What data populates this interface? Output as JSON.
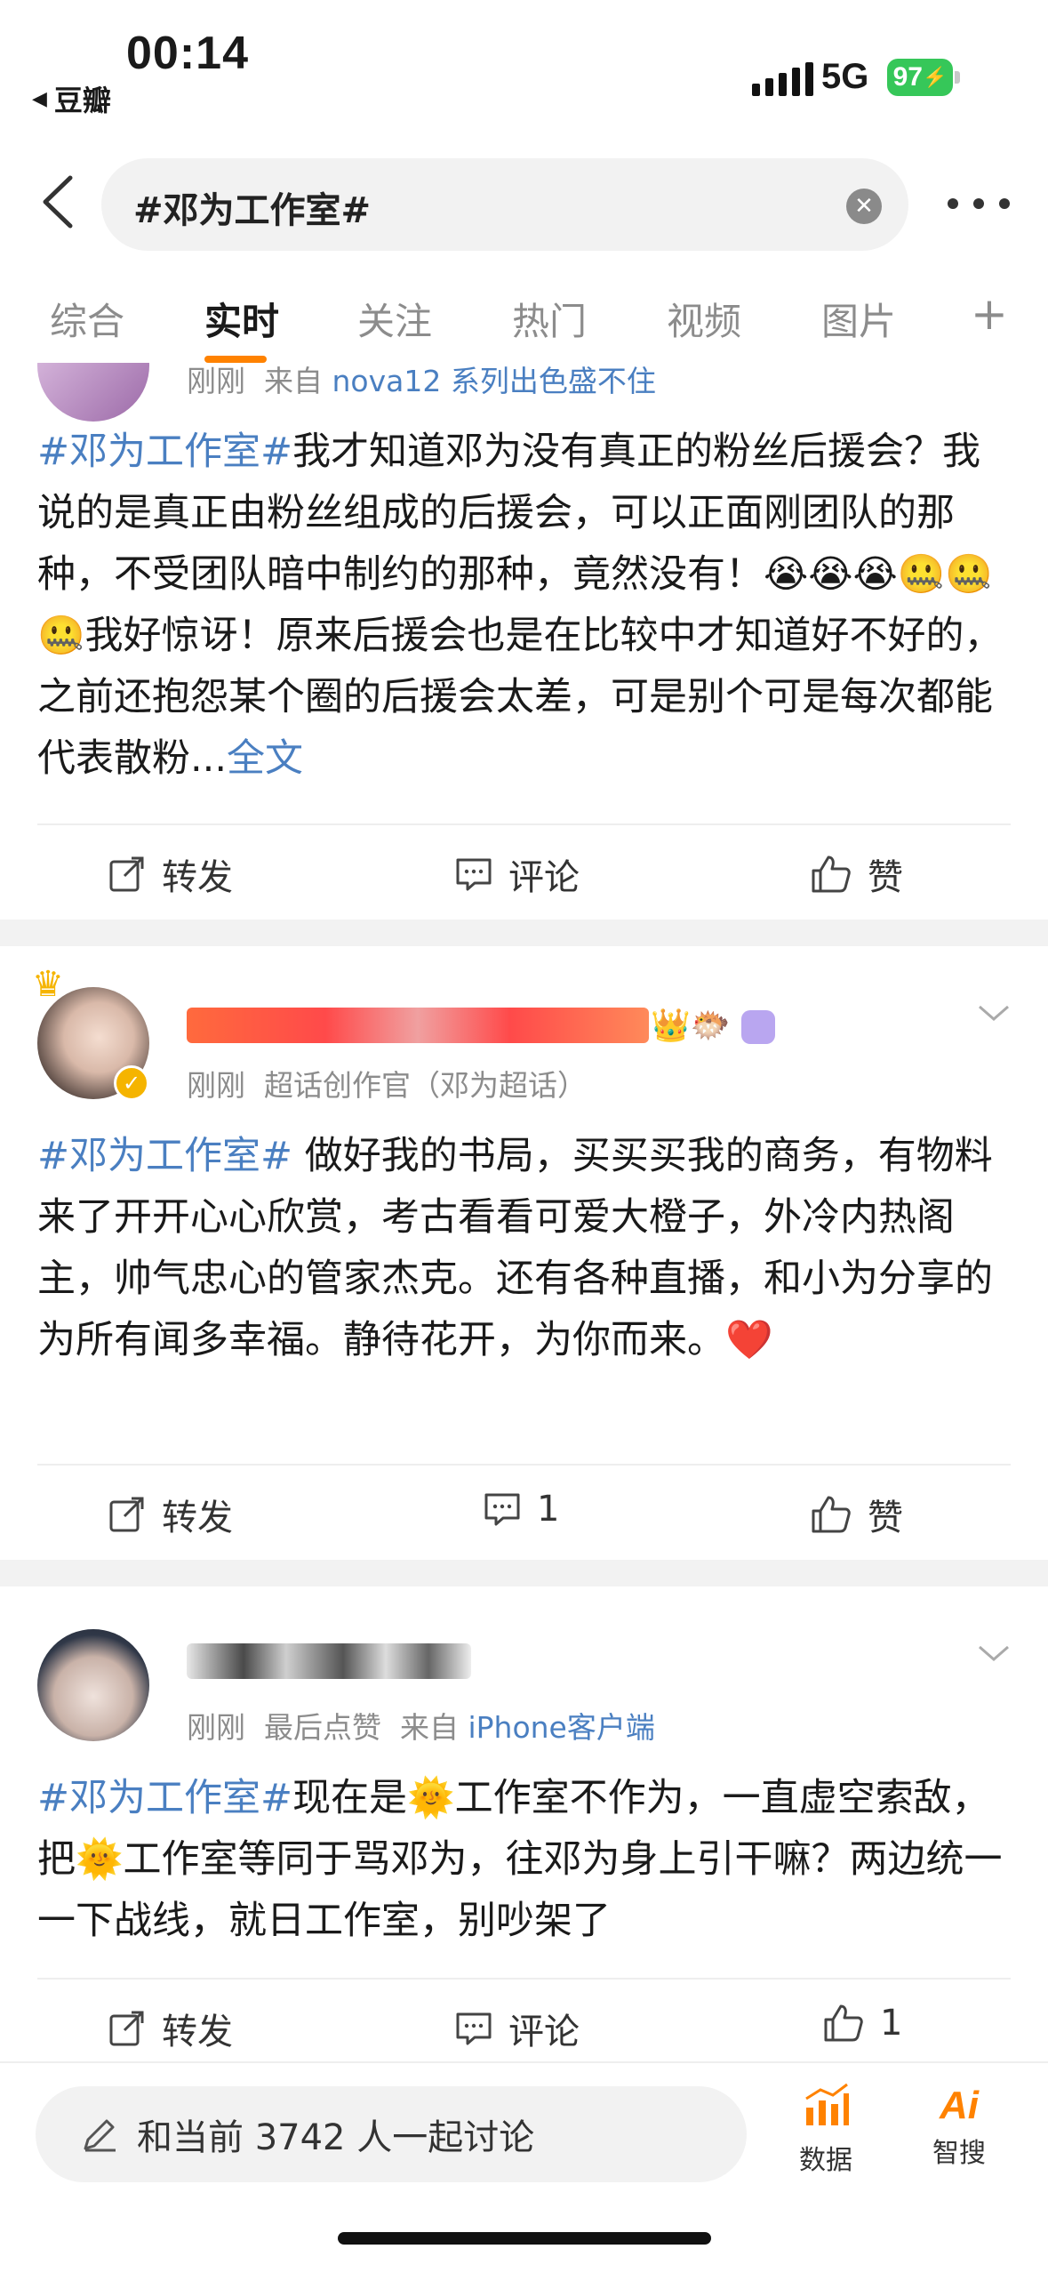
{
  "status_bar": {
    "time": "00:14",
    "back_app": "豆瓣",
    "network": "5G",
    "battery": "97"
  },
  "search": {
    "query": "#邓为工作室#"
  },
  "tabs": [
    {
      "label": "综合"
    },
    {
      "label": "实时"
    },
    {
      "label": "关注"
    },
    {
      "label": "热门"
    },
    {
      "label": "视频"
    },
    {
      "label": "图片"
    }
  ],
  "active_tab": "实时",
  "posts": [
    {
      "meta_time": "刚刚",
      "meta_source_prefix": "来自",
      "meta_source": "nova12 系列出色盛不住",
      "hashtag": "#邓为工作室#",
      "text": "我才知道邓为没有真正的粉丝后援会？我说的是真正由粉丝组成的后援会，可以正面刚团队的那种，不受团队暗中制约的那种，竟然没有！😭😭😭🤐🤐🤐我好惊讶！原来后援会也是在比较中才知道好不好的，之前还抱怨某个圈的后援会太差，可是别个可是每次都能代表散粉...",
      "more": "全文",
      "repost": "转发",
      "comment": "评论",
      "like": "赞"
    },
    {
      "meta_time": "刚刚",
      "meta_role": "超话创作官（邓为超话）",
      "hashtag": "#邓为工作室#",
      "text": " 做好我的书局，买买买我的商务，有物料来了开开心心欣赏，考古看看可爱大橙子，外冷内热阁主，帅气忠心的管家杰克。还有各种直播，和小为分享的为所有闻多幸福。静待花开，为你而来。❤️",
      "repost": "转发",
      "comment": "1",
      "like": "赞"
    },
    {
      "meta_time": "刚刚",
      "meta_extra": "最后点赞",
      "meta_source_prefix": "来自",
      "meta_source": "iPhone客户端",
      "hashtag": "#邓为工作室#",
      "text_part1": "现在是",
      "text_part2": "工作室不作为，一直虚空索敌，把",
      "text_part3": "工作室等同于骂邓为，往邓为身上引干嘛？两边统一一下战线，就日工作室，别吵架了",
      "repost": "转发",
      "comment": "评论",
      "like": "1"
    }
  ],
  "bottom": {
    "discuss": "和当前 3742 人一起讨论",
    "data_label": "数据",
    "ai_label": "智搜",
    "ai_logo": "Ai"
  },
  "colors": {
    "accent": "#ff8200",
    "link": "#4a7fc1",
    "battery": "#36c759"
  }
}
